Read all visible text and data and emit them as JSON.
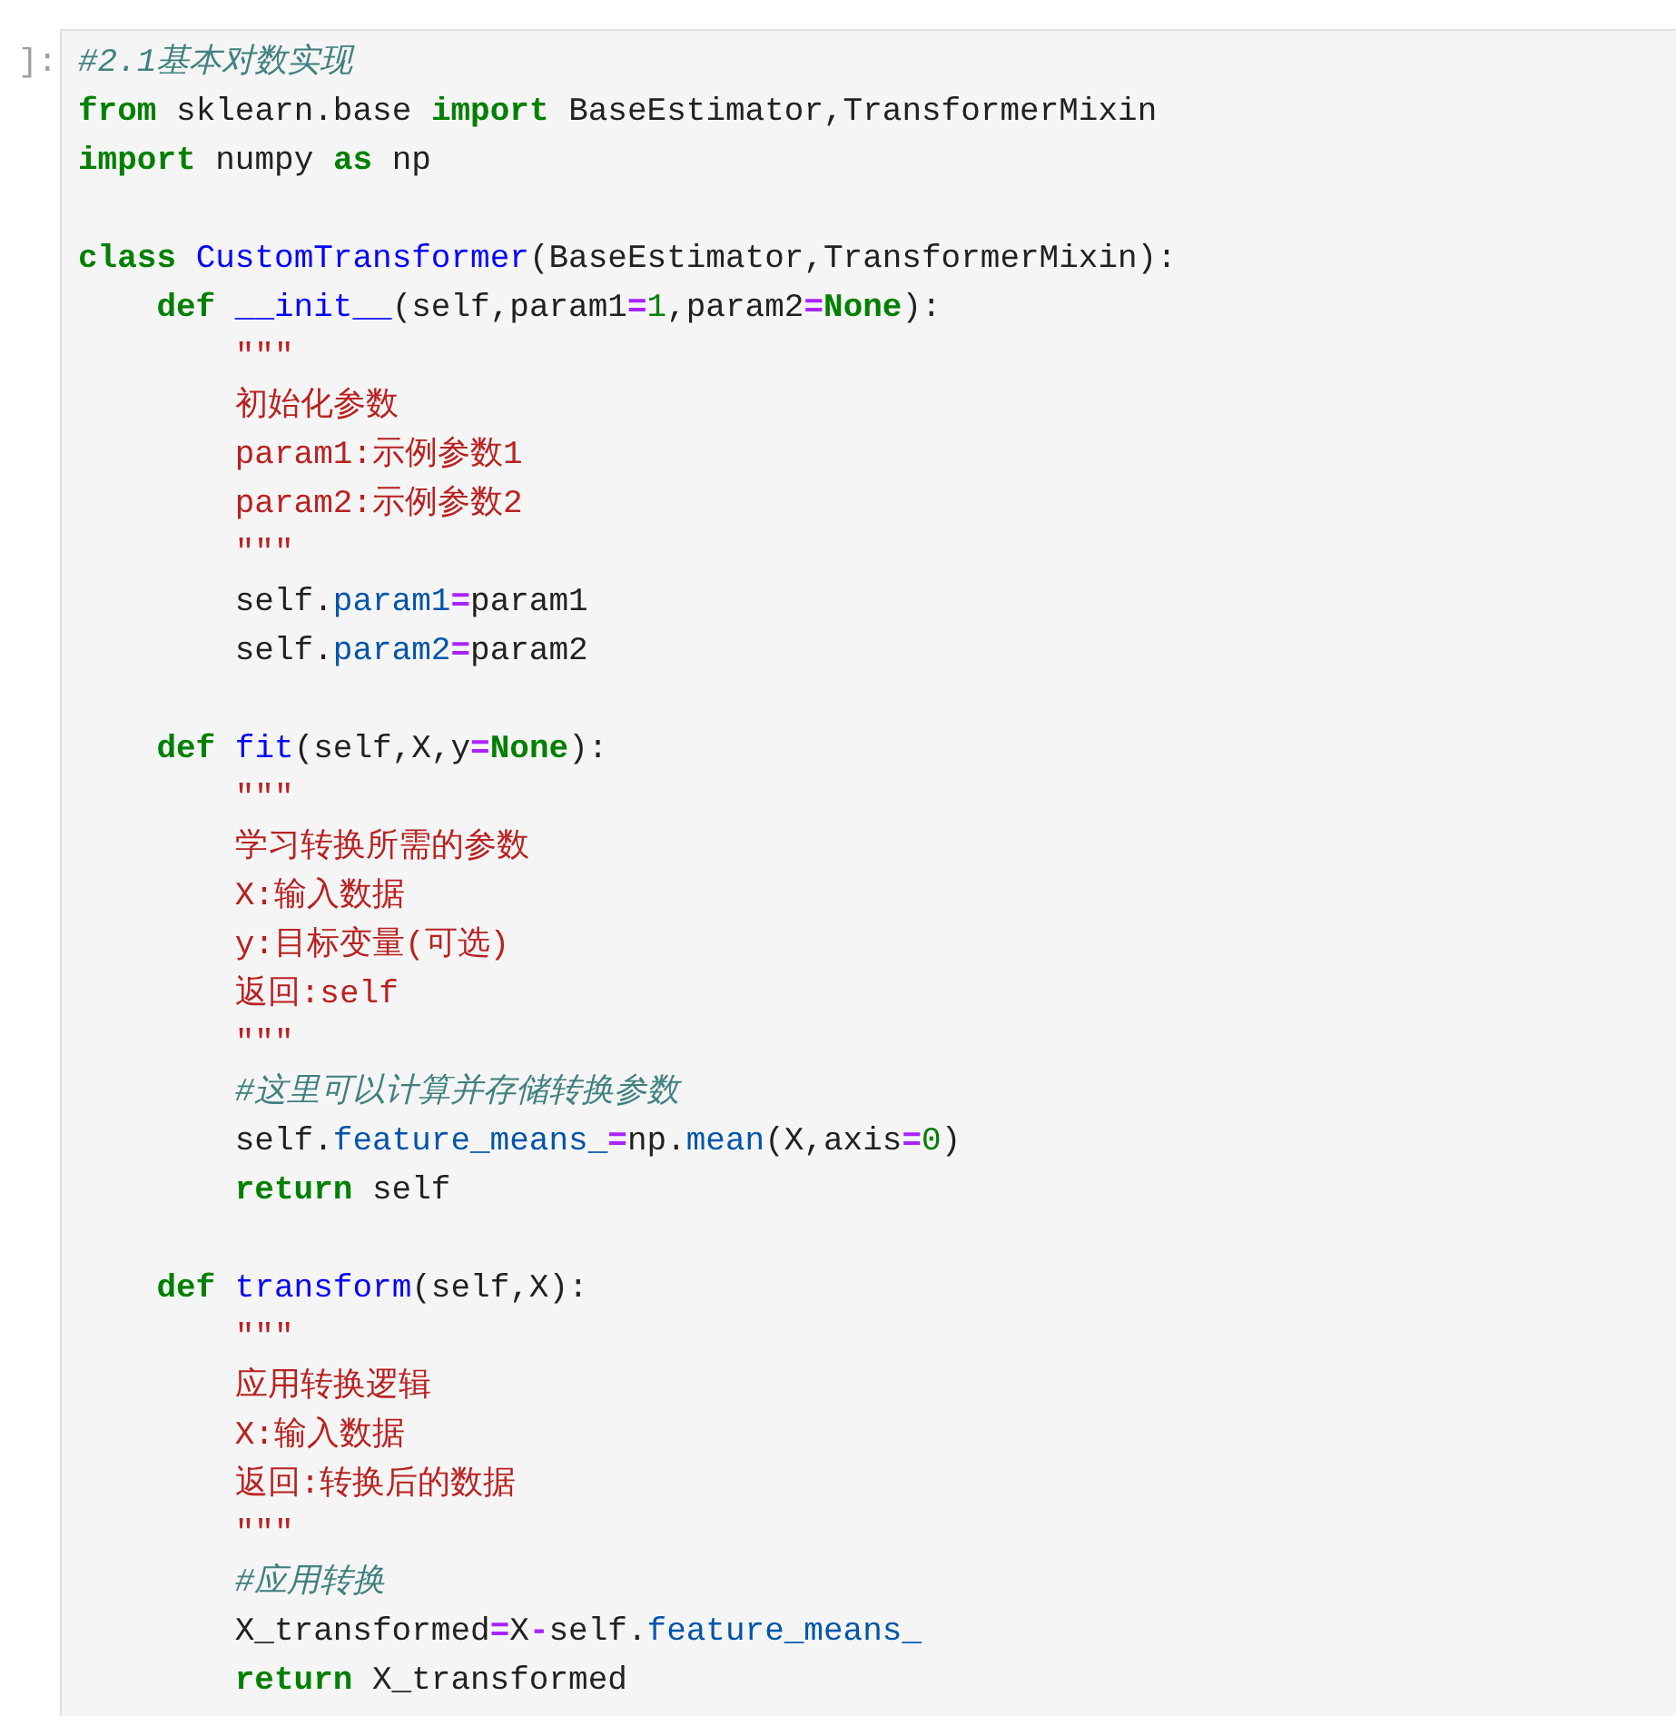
{
  "cell": {
    "prompt": "]:",
    "lines": [
      {
        "kind": "code",
        "tokens": [
          {
            "kind": "comment",
            "text": "#2.1基本对数实现"
          }
        ]
      },
      {
        "kind": "code",
        "tokens": [
          {
            "kind": "keyword",
            "text": "from "
          },
          {
            "kind": "plain",
            "text": "sklearn.base "
          },
          {
            "kind": "keyword",
            "text": "import "
          },
          {
            "kind": "plain",
            "text": "BaseEstimator,TransformerMixin"
          }
        ]
      },
      {
        "kind": "code",
        "tokens": [
          {
            "kind": "keyword",
            "text": "import "
          },
          {
            "kind": "plain",
            "text": "numpy "
          },
          {
            "kind": "keyword",
            "text": "as "
          },
          {
            "kind": "plain",
            "text": "np"
          }
        ]
      },
      {
        "kind": "blank"
      },
      {
        "kind": "code",
        "tokens": [
          {
            "kind": "keyword",
            "text": "class "
          },
          {
            "kind": "name",
            "text": "CustomTransformer"
          },
          {
            "kind": "plain",
            "text": "(BaseEstimator,TransformerMixin):"
          }
        ],
        "children": [
          {
            "kind": "code",
            "tokens": [
              {
                "kind": "keyword",
                "text": "def "
              },
              {
                "kind": "name",
                "text": "__init__"
              },
              {
                "kind": "plain",
                "text": "(self,param1"
              },
              {
                "kind": "operator",
                "text": "="
              },
              {
                "kind": "number",
                "text": "1"
              },
              {
                "kind": "plain",
                "text": ",param2"
              },
              {
                "kind": "operator",
                "text": "="
              },
              {
                "kind": "keyword",
                "text": "None"
              },
              {
                "kind": "plain",
                "text": "):"
              }
            ],
            "children": [
              {
                "kind": "code",
                "tokens": [
                  {
                    "kind": "string",
                    "text": "\"\"\""
                  }
                ]
              },
              {
                "kind": "code",
                "tokens": [
                  {
                    "kind": "string",
                    "text": "初始化参数"
                  }
                ]
              },
              {
                "kind": "code",
                "tokens": [
                  {
                    "kind": "string",
                    "text": "param1:示例参数1"
                  }
                ]
              },
              {
                "kind": "code",
                "tokens": [
                  {
                    "kind": "string",
                    "text": "param2:示例参数2"
                  }
                ]
              },
              {
                "kind": "code",
                "tokens": [
                  {
                    "kind": "string",
                    "text": "\"\"\""
                  }
                ]
              },
              {
                "kind": "code",
                "tokens": [
                  {
                    "kind": "plain",
                    "text": "self."
                  },
                  {
                    "kind": "attribute",
                    "text": "param1"
                  },
                  {
                    "kind": "operator",
                    "text": "="
                  },
                  {
                    "kind": "plain",
                    "text": "param1"
                  }
                ]
              },
              {
                "kind": "code",
                "tokens": [
                  {
                    "kind": "plain",
                    "text": "self."
                  },
                  {
                    "kind": "attribute",
                    "text": "param2"
                  },
                  {
                    "kind": "operator",
                    "text": "="
                  },
                  {
                    "kind": "plain",
                    "text": "param2"
                  }
                ]
              }
            ]
          },
          {
            "kind": "blank"
          },
          {
            "kind": "code",
            "tokens": [
              {
                "kind": "keyword",
                "text": "def "
              },
              {
                "kind": "name",
                "text": "fit"
              },
              {
                "kind": "plain",
                "text": "(self,X,y"
              },
              {
                "kind": "operator",
                "text": "="
              },
              {
                "kind": "keyword",
                "text": "None"
              },
              {
                "kind": "plain",
                "text": "):"
              }
            ],
            "children": [
              {
                "kind": "code",
                "tokens": [
                  {
                    "kind": "string",
                    "text": "\"\"\""
                  }
                ]
              },
              {
                "kind": "code",
                "tokens": [
                  {
                    "kind": "string",
                    "text": "学习转换所需的参数"
                  }
                ]
              },
              {
                "kind": "code",
                "tokens": [
                  {
                    "kind": "string",
                    "text": "X:输入数据"
                  }
                ]
              },
              {
                "kind": "code",
                "tokens": [
                  {
                    "kind": "string",
                    "text": "y:目标变量(可选)"
                  }
                ]
              },
              {
                "kind": "code",
                "tokens": [
                  {
                    "kind": "string",
                    "text": "返回:self"
                  }
                ]
              },
              {
                "kind": "code",
                "tokens": [
                  {
                    "kind": "string",
                    "text": "\"\"\""
                  }
                ]
              },
              {
                "kind": "code",
                "tokens": [
                  {
                    "kind": "comment",
                    "text": "#这里可以计算并存储转换参数"
                  }
                ]
              },
              {
                "kind": "code",
                "tokens": [
                  {
                    "kind": "plain",
                    "text": "self."
                  },
                  {
                    "kind": "attribute",
                    "text": "feature_means_"
                  },
                  {
                    "kind": "operator",
                    "text": "="
                  },
                  {
                    "kind": "plain",
                    "text": "np."
                  },
                  {
                    "kind": "attribute",
                    "text": "mean"
                  },
                  {
                    "kind": "plain",
                    "text": "(X,axis"
                  },
                  {
                    "kind": "operator",
                    "text": "="
                  },
                  {
                    "kind": "number",
                    "text": "0"
                  },
                  {
                    "kind": "plain",
                    "text": ")"
                  }
                ]
              },
              {
                "kind": "code",
                "tokens": [
                  {
                    "kind": "keyword",
                    "text": "return "
                  },
                  {
                    "kind": "plain",
                    "text": "self"
                  }
                ]
              }
            ]
          },
          {
            "kind": "blank"
          },
          {
            "kind": "code",
            "tokens": [
              {
                "kind": "keyword",
                "text": "def "
              },
              {
                "kind": "name",
                "text": "transform"
              },
              {
                "kind": "plain",
                "text": "(self,X):"
              }
            ],
            "children": [
              {
                "kind": "code",
                "tokens": [
                  {
                    "kind": "string",
                    "text": "\"\"\""
                  }
                ]
              },
              {
                "kind": "code",
                "tokens": [
                  {
                    "kind": "string",
                    "text": "应用转换逻辑"
                  }
                ]
              },
              {
                "kind": "code",
                "tokens": [
                  {
                    "kind": "string",
                    "text": "X:输入数据"
                  }
                ]
              },
              {
                "kind": "code",
                "tokens": [
                  {
                    "kind": "string",
                    "text": "返回:转换后的数据"
                  }
                ]
              },
              {
                "kind": "code",
                "tokens": [
                  {
                    "kind": "string",
                    "text": "\"\"\""
                  }
                ]
              },
              {
                "kind": "code",
                "tokens": [
                  {
                    "kind": "comment",
                    "text": "#应用转换"
                  }
                ]
              },
              {
                "kind": "code",
                "tokens": [
                  {
                    "kind": "plain",
                    "text": "X_transformed"
                  },
                  {
                    "kind": "operator",
                    "text": "="
                  },
                  {
                    "kind": "plain",
                    "text": "X"
                  },
                  {
                    "kind": "operator",
                    "text": "-"
                  },
                  {
                    "kind": "plain",
                    "text": "self."
                  },
                  {
                    "kind": "attribute",
                    "text": "feature_means_"
                  }
                ]
              },
              {
                "kind": "code",
                "tokens": [
                  {
                    "kind": "keyword",
                    "text": "return "
                  },
                  {
                    "kind": "plain",
                    "text": "X_transformed"
                  }
                ]
              }
            ]
          }
        ]
      }
    ]
  }
}
